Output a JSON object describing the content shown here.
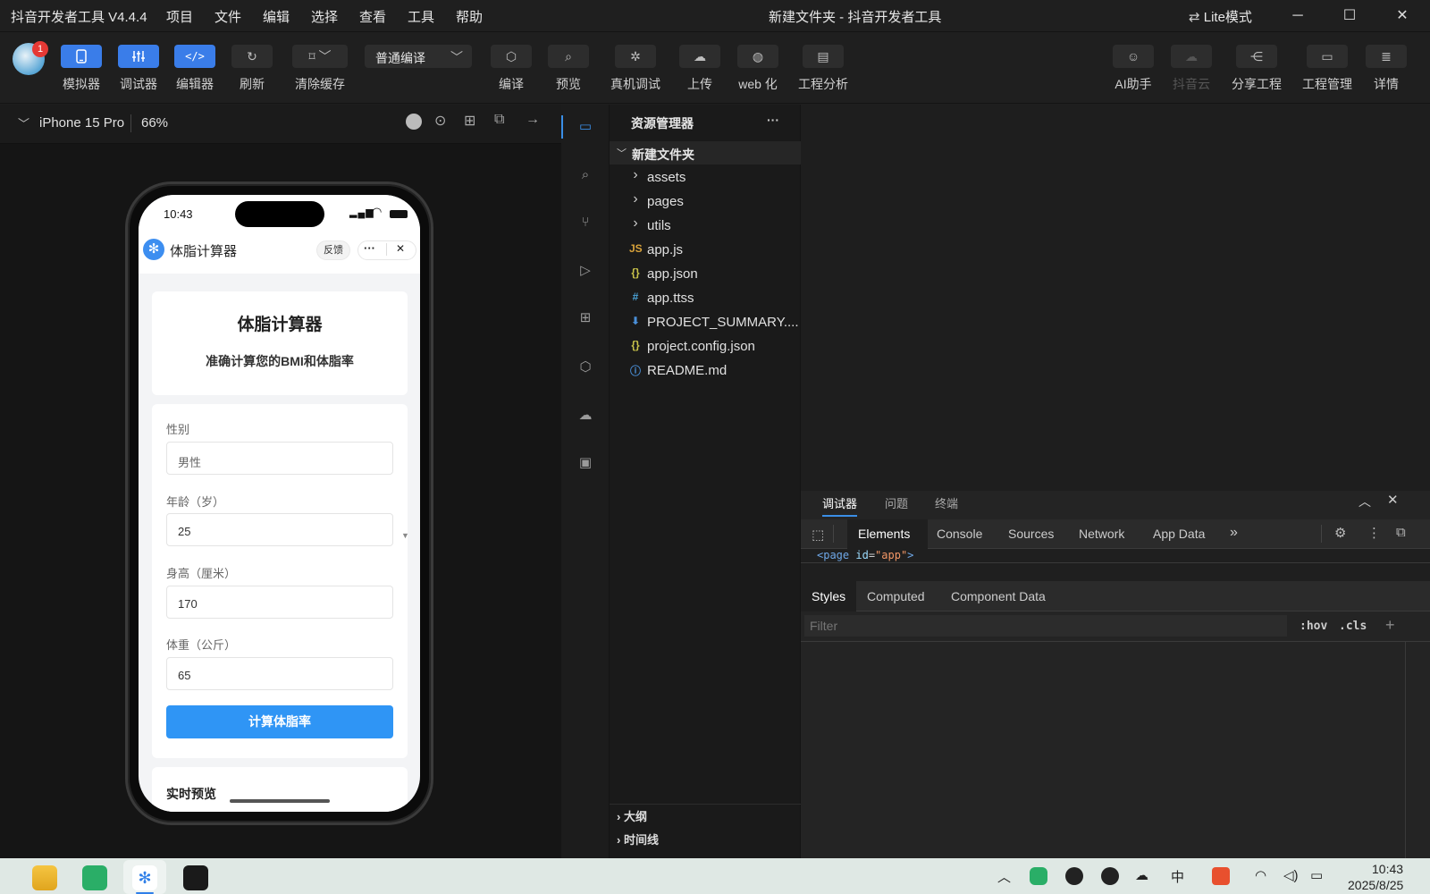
{
  "titlebar": {
    "app_name": "抖音开发者工具 V4.4.4",
    "menu": [
      "项目",
      "文件",
      "编辑",
      "选择",
      "查看",
      "工具",
      "帮助"
    ],
    "window_title": "新建文件夹 - 抖音开发者工具",
    "lite_mode": "Lite模式",
    "lite_icon": "swap-arrows-icon"
  },
  "toolbar": {
    "avatar_badge": "1",
    "left": [
      {
        "label": "模拟器",
        "icon": "phone-icon"
      },
      {
        "label": "调试器",
        "icon": "sliders-icon"
      },
      {
        "label": "编辑器",
        "icon": "code-icon"
      },
      {
        "label": "刷新",
        "icon": "refresh-icon"
      },
      {
        "label": "清除缓存",
        "icon": "broom-icon"
      }
    ],
    "compile_mode": "普通编译",
    "middle": [
      {
        "label": "编译",
        "icon": "cube-icon"
      },
      {
        "label": "预览",
        "icon": "preview-icon"
      },
      {
        "label": "真机调试",
        "icon": "bug-icon"
      },
      {
        "label": "上传",
        "icon": "cloud-upload-icon"
      },
      {
        "label": "web 化",
        "icon": "globe-icon"
      },
      {
        "label": "工程分析",
        "icon": "analysis-icon"
      }
    ],
    "right": [
      {
        "label": "AI助手",
        "icon": "robot-icon"
      },
      {
        "label": "抖音云",
        "icon": "cloud-icon",
        "disabled": true
      },
      {
        "label": "分享工程",
        "icon": "share-icon"
      },
      {
        "label": "工程管理",
        "icon": "clipboard-icon"
      },
      {
        "label": "详情",
        "icon": "details-icon"
      }
    ]
  },
  "simulator": {
    "device": "iPhone 15 Pro",
    "zoom": "66%",
    "status_time": "10:43",
    "nav_title": "体脂计算器",
    "feedback": "反馈",
    "more": "···",
    "close": "✕",
    "card_title": "体脂计算器",
    "card_subtitle": "准确计算您的BMI和体脂率",
    "fields": [
      {
        "label": "性别",
        "value": "男性",
        "placeholder": true
      },
      {
        "label": "年龄（岁）",
        "value": "25"
      },
      {
        "label": "身高（厘米）",
        "value": "170"
      },
      {
        "label": "体重（公斤）",
        "value": "65"
      }
    ],
    "submit": "计算体脂率",
    "preview_title": "实时预览"
  },
  "explorer": {
    "header": "资源管理器",
    "more": "···",
    "root": "新建文件夹",
    "items": [
      {
        "name": "assets",
        "type": "folder",
        "icon": "chevron-right-icon"
      },
      {
        "name": "pages",
        "type": "folder",
        "icon": "chevron-right-icon"
      },
      {
        "name": "utils",
        "type": "folder",
        "icon": "chevron-right-icon"
      },
      {
        "name": "app.js",
        "type": "js",
        "icon": "js-file-icon",
        "glyph": "JS",
        "color": "#d8a23a"
      },
      {
        "name": "app.json",
        "type": "json",
        "icon": "json-file-icon",
        "glyph": "{}",
        "color": "#c9c34a"
      },
      {
        "name": "app.ttss",
        "type": "css",
        "icon": "hash-file-icon",
        "glyph": "#",
        "color": "#4aa3d8"
      },
      {
        "name": "PROJECT_SUMMARY....",
        "type": "md",
        "icon": "download-file-icon",
        "glyph": "⬇",
        "color": "#4a8fd8"
      },
      {
        "name": "project.config.json",
        "type": "json",
        "icon": "json-file-icon",
        "glyph": "{}",
        "color": "#c9c34a"
      },
      {
        "name": "README.md",
        "type": "md",
        "icon": "info-file-icon",
        "glyph": "ⓘ",
        "color": "#4a8fd8"
      }
    ],
    "outline": "大纲",
    "timeline": "时间线"
  },
  "devtools": {
    "tabs": [
      "调试器",
      "问题",
      "终端"
    ],
    "inner_tabs": [
      "Elements",
      "Console",
      "Sources",
      "Network",
      "App Data"
    ],
    "dom_line": {
      "open": "<page ",
      "attr": "id",
      "eq": "=",
      "val": "\"app\"",
      "close": ">"
    },
    "styles_tabs": [
      "Styles",
      "Computed",
      "Component Data"
    ],
    "filter_placeholder": "Filter",
    "hov": ":hov",
    "cls": ".cls",
    "plus": "+"
  },
  "taskbar": {
    "time": "10:43",
    "date": "2025/8/25",
    "ime": "中"
  }
}
